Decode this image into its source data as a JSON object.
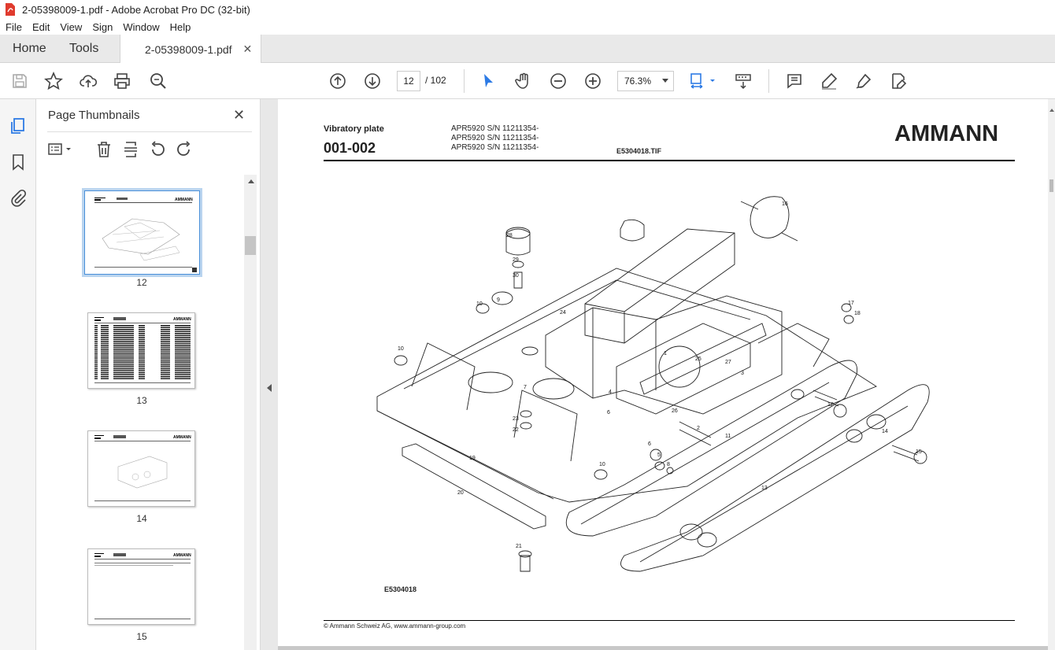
{
  "window": {
    "title": "2-05398009-1.pdf - Adobe Acrobat Pro DC (32-bit)"
  },
  "menu": [
    "File",
    "Edit",
    "View",
    "Sign",
    "Window",
    "Help"
  ],
  "tabs": {
    "home": "Home",
    "tools": "Tools",
    "document": "2-05398009-1.pdf"
  },
  "toolbar": {
    "page_current": "12",
    "page_total": "/ 102",
    "zoom": "76.3%"
  },
  "panel": {
    "title": "Page Thumbnails",
    "thumbnails": [
      {
        "label": "12",
        "selected": true
      },
      {
        "label": "13",
        "selected": false
      },
      {
        "label": "14",
        "selected": false
      },
      {
        "label": "15",
        "selected": false
      }
    ]
  },
  "document_page": {
    "title": "Vibratory plate",
    "section": "001-002",
    "serials": [
      "APR5920 S/N 11211354-",
      "APR5920 S/N 11211354-",
      "APR5920 S/N 11211354-"
    ],
    "image_file": "E5304018.TIF",
    "logo": "AMMANN",
    "drawing_code": "E5304018",
    "footer": "© Ammann Schweiz AG, www.ammann-group.com",
    "callouts": [
      "16",
      "28",
      "29",
      "30",
      "9",
      "10",
      "24",
      "10",
      "1",
      "25",
      "27",
      "3",
      "4",
      "7",
      "6",
      "26",
      "2",
      "11",
      "23",
      "22",
      "6",
      "5",
      "8",
      "12",
      "14",
      "15",
      "19",
      "10",
      "13",
      "20",
      "21",
      "17",
      "18"
    ]
  },
  "colors": {
    "accent": "#2d7be5",
    "tabbar": "#e9e9e9",
    "selected_thumb": "#4a90d9"
  }
}
